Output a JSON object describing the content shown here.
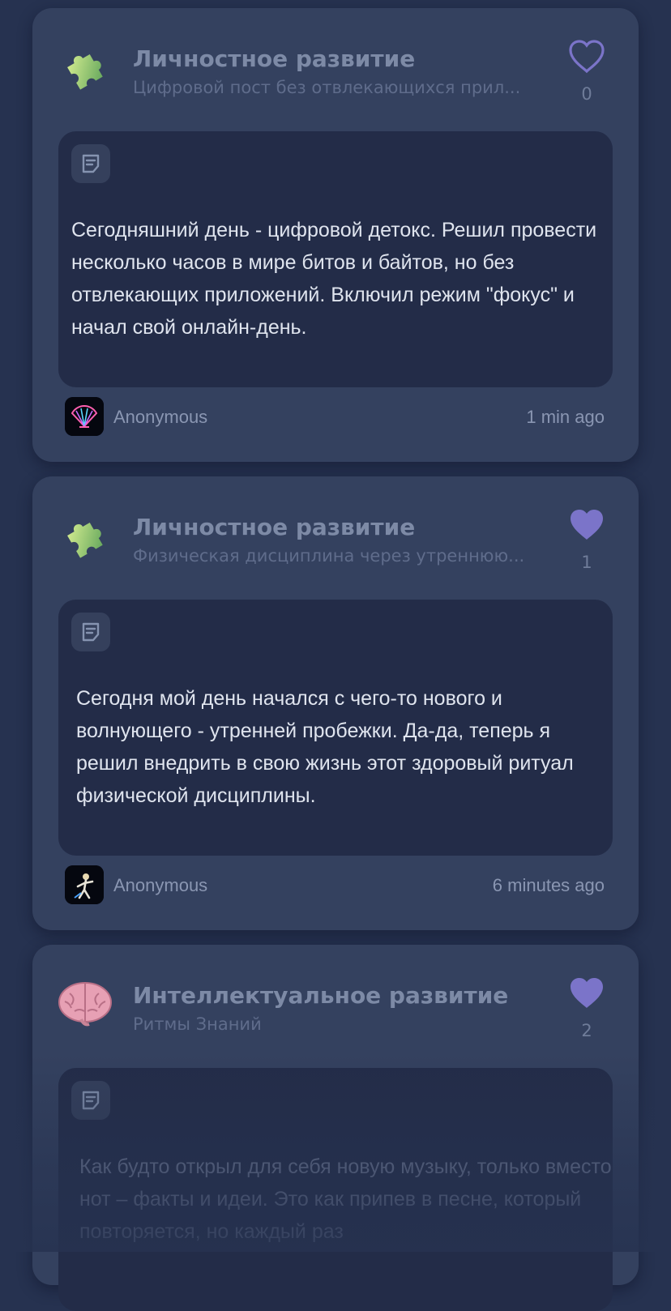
{
  "posts": [
    {
      "category_icon": "puzzle-icon",
      "title": "Личностное развитие",
      "subtitle": "Цифровой пост без отвлекающихся прил...",
      "liked": false,
      "likes": "0",
      "note_icon": "note-icon",
      "text": "Сегодняшний день - цифровой детокс. Решил провести несколько часов в мире битов и байтов, но без отвлекающих приложений. Включил режим \"фокус\" и начал свой онлайн-день.",
      "avatar_icon": "shell-avatar-icon",
      "author": "Anonymous",
      "time": "1 min ago"
    },
    {
      "category_icon": "puzzle-icon",
      "title": "Личностное развитие",
      "subtitle": "Физическая дисциплина через утреннюю...",
      "liked": true,
      "likes": "1",
      "note_icon": "note-icon",
      "text": "Сегодня мой день начался с чего-то нового и волнующего - утренней пробежки. Да-да, теперь я решил внедрить в свою жизнь этот здоровый ритуал физической дисциплины.",
      "avatar_icon": "figure-avatar-icon",
      "author": "Anonymous",
      "time": "6 minutes ago"
    },
    {
      "category_icon": "brain-icon",
      "title": "Интеллектуальное развитие",
      "subtitle": "Ритмы Знаний",
      "liked": true,
      "likes": "2",
      "note_icon": "note-icon",
      "text": "Как будто открыл для себя новую музыку, только вместо нот – факты и идеи. Это как припев в песне, который повторяется, но каждый раз"
    }
  ],
  "colors": {
    "background": "#263250",
    "card": "#34415f",
    "content_box": "#232c48",
    "heart_accent": "#7b74c9"
  }
}
